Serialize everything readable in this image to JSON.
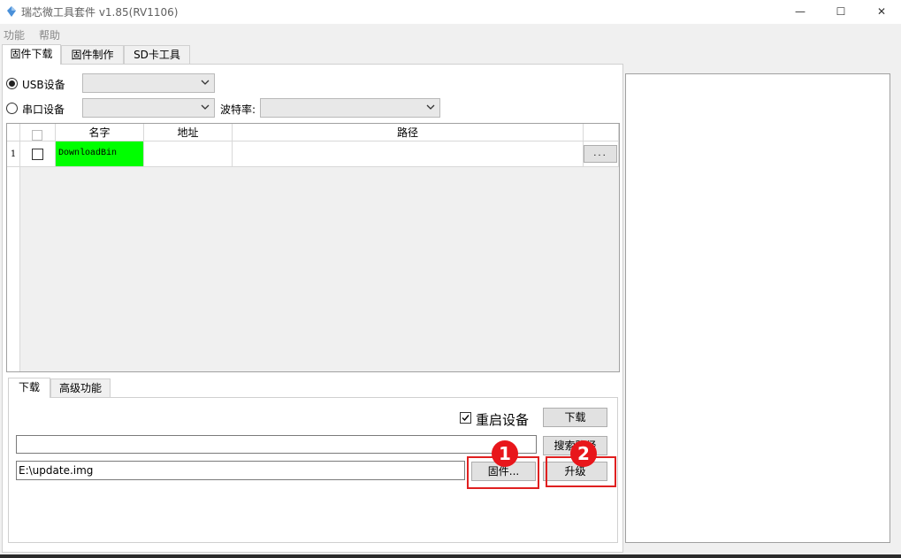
{
  "window": {
    "title": "瑞芯微工具套件 v1.85(RV1106)",
    "minimize_glyph": "—",
    "maximize_glyph": "☐",
    "close_glyph": "✕"
  },
  "menu": {
    "items": [
      "功能",
      "帮助"
    ]
  },
  "main_tabs": [
    "固件下载",
    "固件制作",
    "SD卡工具"
  ],
  "device": {
    "usb_label": "USB设备",
    "serial_label": "串口设备",
    "baud_label": "波特率:",
    "usb_value": "",
    "serial_value": "",
    "baud_value": ""
  },
  "table": {
    "columns": [
      "名字",
      "地址",
      "路径"
    ],
    "rows": [
      {
        "index": "1",
        "name": "DownloadBin",
        "address": "",
        "path": "",
        "browse_label": "..."
      }
    ]
  },
  "sub_tabs": [
    "下载",
    "高级功能"
  ],
  "download": {
    "reboot_label": "重启设备",
    "reboot_checked": true,
    "download_button": "下载",
    "search_field_value": "",
    "search_button": "搜索路径",
    "firmware_path": "E:\\update.img",
    "firmware_button": "固件...",
    "upgrade_button": "升级"
  },
  "annotations": {
    "badge1": "1",
    "badge2": "2",
    "highlight_color": "#e02020"
  },
  "colors": {
    "name_cell": "#00ff00"
  }
}
